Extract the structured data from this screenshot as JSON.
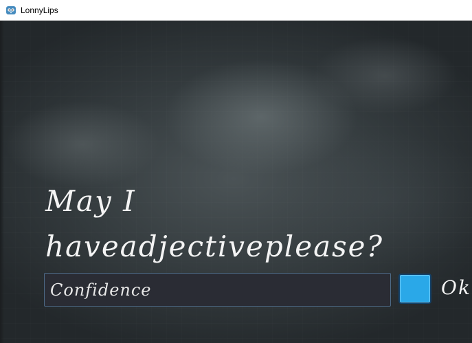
{
  "window": {
    "title": "LonnyLips",
    "icon": "godot-engine-icon"
  },
  "game": {
    "prompt_line1": "May I",
    "prompt_line2": "haveadjectiveplease?",
    "input": {
      "value": "Confidence",
      "placeholder": ""
    },
    "ok_label": "Ok",
    "colors": {
      "background": "#3a4144",
      "text": "#f4f4f4",
      "input_bg": "#2a2c34",
      "input_border": "#4d6a86",
      "button": "#2aa8e8"
    }
  }
}
